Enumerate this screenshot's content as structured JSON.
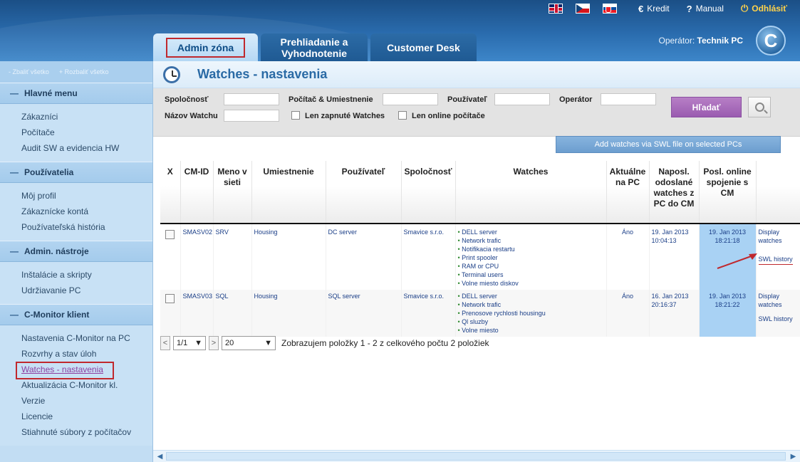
{
  "header": {
    "topnav": {
      "kredit": "Kredit",
      "manual": "Manual",
      "logout": "Odhlásiť"
    },
    "tabs": {
      "admin": "Admin zóna",
      "prehliadanie_1": "Prehliadanie a",
      "prehliadanie_2": "Vyhodnotenie",
      "customer": "Customer Desk"
    },
    "operator_label": "Operátor:",
    "operator_name": "Technik PC",
    "logo_letter": "C"
  },
  "sidebar": {
    "collapse_all": "- Zbaliť všetko",
    "expand_all": "+ Rozbaliť všetko",
    "sections": {
      "main": {
        "title": "Hlavné menu",
        "items": [
          "Zákazníci",
          "Počítače",
          "Audit SW a evidencia HW"
        ]
      },
      "users": {
        "title": "Používatelia",
        "items": [
          "Môj profil",
          "Zákaznícke kontá",
          "Používateľská história"
        ]
      },
      "admin": {
        "title": "Admin. nástroje",
        "items": [
          "Inštalácie a skripty",
          "Udržiavanie PC"
        ]
      },
      "client": {
        "title": "C-Monitor klient",
        "items": [
          "Nastavenia C-Monitor na PC",
          "Rozvrhy a stav úloh",
          "Watches - nastavenia",
          "Aktualizácia C-Monitor kl.",
          "Verzie",
          "Licencie",
          "Stiahnuté súbory z počítačov"
        ]
      }
    }
  },
  "page": {
    "title": "Watches - nastavenia"
  },
  "filters": {
    "company": "Spoločnosť",
    "pc_location": "Počítač & Umiestnenie",
    "user": "Používateľ",
    "operator": "Operátor",
    "watch_name": "Názov Watchu",
    "only_enabled": "Len zapnuté Watches",
    "only_online": "Len online počítače",
    "search": "Hľadať"
  },
  "add_swl_button": "Add watches via SWL file on selected PCs",
  "table": {
    "headers": {
      "x": "X",
      "cmid": "CM-ID",
      "name_1": "Meno v",
      "name_2": "sieti",
      "location": "Umiestnenie",
      "user": "Používateľ",
      "company": "Spoločnosť",
      "watches": "Watches",
      "current_1": "Aktuálne",
      "current_2": "na PC",
      "last_sent_1": "Naposl.",
      "last_sent_2": "odoslané",
      "last_sent_3": "watches z",
      "last_sent_4": "PC do CM",
      "last_online_1": "Posl. online",
      "last_online_2": "spojenie s",
      "last_online_3": "CM"
    },
    "rows": [
      {
        "cmid": "SMASV02",
        "name": "SRV",
        "location": "Housing",
        "user": "DC server",
        "company": "Smavice s.r.o.",
        "watches": [
          "DELL server",
          "Network trafic",
          "Notifikacia restartu",
          "Print spooler",
          "RAM or CPU",
          "Terminal users",
          "Volne miesto diskov"
        ],
        "current": "Áno",
        "sent_date": "19. Jan 2013",
        "sent_time": "10:04:13",
        "online_date": "19. Jan 2013",
        "online_time": "18:21:18",
        "display_1": "Display",
        "display_2": "watches",
        "swl": "SWL history"
      },
      {
        "cmid": "SMASV03",
        "name": "SQL",
        "location": "Housing",
        "user": "SQL server",
        "company": "Smavice s.r.o.",
        "watches": [
          "DELL server",
          "Network trafic",
          "Prenosove rychlosti housingu",
          "Ql sluzby",
          "Volne miesto"
        ],
        "current": "Áno",
        "sent_date": "16. Jan 2013",
        "sent_time": "20:16:37",
        "online_date": "19. Jan 2013",
        "online_time": "18:21:22",
        "display_1": "Display",
        "display_2": "watches",
        "swl": "SWL history"
      }
    ]
  },
  "pager": {
    "page": "1/1",
    "size": "20",
    "info": "Zobrazujem položky 1 - 2 z celkového počtu 2 položiek"
  },
  "icons": {
    "prev": "chevron-left-icon",
    "next": "chevron-right-icon",
    "dropdown": "triangle-down-icon"
  }
}
